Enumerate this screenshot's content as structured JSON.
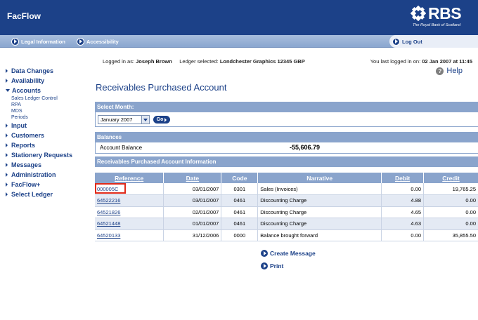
{
  "app": {
    "title": "FacFlow"
  },
  "brand": {
    "name": "RBS",
    "tagline": "The Royal Bank of Scotland"
  },
  "nav": {
    "legal": "Legal Information",
    "accessibility": "Accessibility",
    "logout": "Log Out"
  },
  "session": {
    "logged_in_label": "Logged in as:",
    "user": "Joseph Brown",
    "ledger_label": "Ledger selected:",
    "ledger": "Londchester Graphics  12345  GBP",
    "last_login_label": "You last logged in on:",
    "last_login": "02 Jan 2007 at 11:45"
  },
  "help": {
    "label": "Help"
  },
  "sidebar": {
    "items": [
      {
        "label": "Data Changes"
      },
      {
        "label": "Availability"
      },
      {
        "label": "Accounts",
        "sub": [
          "Sales Ledger Control",
          "RPA",
          "MDS",
          "Periods"
        ]
      },
      {
        "label": "Input"
      },
      {
        "label": "Customers"
      },
      {
        "label": "Reports"
      },
      {
        "label": "Stationery Requests"
      },
      {
        "label": "Messages"
      },
      {
        "label": "Administration"
      },
      {
        "label": "FacFlow+"
      },
      {
        "label": "Select Ledger"
      }
    ]
  },
  "page": {
    "title": "Receivables Purchased Account"
  },
  "select_month": {
    "header": "Select Month:",
    "value": "January 2007",
    "go": "Go"
  },
  "balances": {
    "header": "Balances",
    "label": "Account Balance",
    "value": "-55,606.79"
  },
  "info": {
    "header": "Receivables Purchased Account Information"
  },
  "table": {
    "columns": [
      "Reference",
      "Date",
      "Code",
      "Narrative",
      "Debit",
      "Credit"
    ],
    "rows": [
      {
        "ref": "000005C",
        "date": "03/01/2007",
        "code": "0301",
        "narrative": "Sales (Invoices)",
        "debit": "0.00",
        "credit": "19,765.25"
      },
      {
        "ref": "64522216",
        "date": "03/01/2007",
        "code": "0461",
        "narrative": "Discounting Charge",
        "debit": "4.88",
        "credit": "0.00"
      },
      {
        "ref": "64521826",
        "date": "02/01/2007",
        "code": "0461",
        "narrative": "Discounting Charge",
        "debit": "4.65",
        "credit": "0.00"
      },
      {
        "ref": "64521448",
        "date": "01/01/2007",
        "code": "0461",
        "narrative": "Discounting Charge",
        "debit": "4.63",
        "credit": "0.00"
      },
      {
        "ref": "64520133",
        "date": "31/12/2006",
        "code": "0000",
        "narrative": "Balance brought forward",
        "debit": "0.00",
        "credit": "35,855.50"
      }
    ]
  },
  "actions": {
    "create_message": "Create Message",
    "print": "Print"
  }
}
